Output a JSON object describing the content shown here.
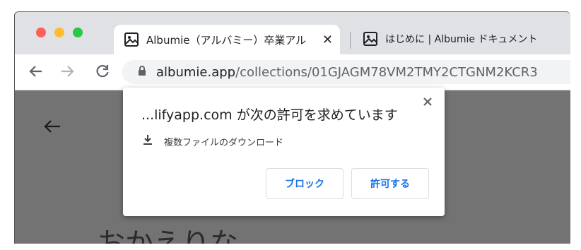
{
  "browser": {
    "tabs": [
      {
        "title": "Albumie（アルバミー）卒業アル",
        "active": true,
        "favicon": "image-icon"
      },
      {
        "title": "はじめに | Albumie ドキュメント",
        "active": false,
        "favicon": "image-icon"
      }
    ],
    "url": {
      "host": "albumie.app",
      "path": "/collections/01GJAGM78VM2TMY2CTGNM2KCR3"
    }
  },
  "page": {
    "heading": "おかえりな"
  },
  "popup": {
    "title": "...lifyapp.com が次の許可を求めています",
    "permission": "複数ファイルのダウンロード",
    "block_label": "ブロック",
    "allow_label": "許可する"
  }
}
